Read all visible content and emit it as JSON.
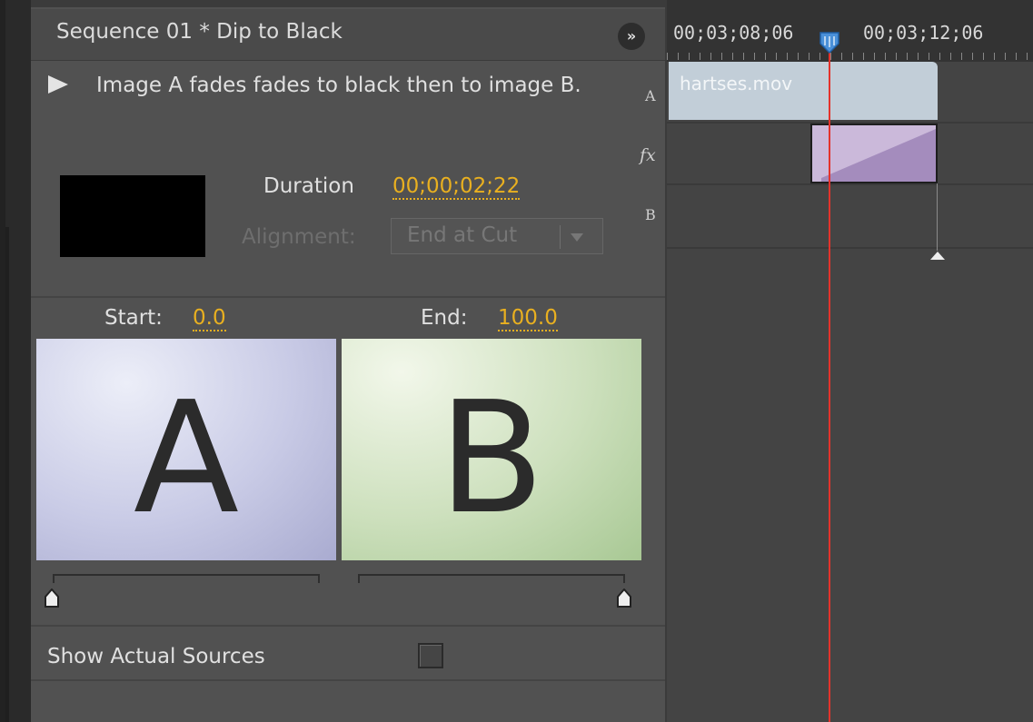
{
  "header": {
    "title": "Sequence 01 * Dip to Black",
    "menu_icon": "panel-menu-icon"
  },
  "effect": {
    "description": "Image A fades fades to black then to image B.",
    "duration_label": "Duration",
    "duration_value": "00;00;02;22",
    "alignment_label": "Alignment:",
    "alignment_value": "End at Cut"
  },
  "track_labels": {
    "a": "A",
    "fx": "fx",
    "b": "B"
  },
  "preview": {
    "start_label": "Start:",
    "start_value": "0.0",
    "end_label": "End:",
    "end_value": "100.0",
    "image_a_letter": "A",
    "image_b_letter": "B",
    "start_slider_fraction": 0.0,
    "end_slider_fraction": 1.0
  },
  "show_actual_sources": {
    "label": "Show Actual Sources",
    "checked": false
  },
  "timeline": {
    "timecode_left": "00;03;08;06",
    "timecode_right": "00;03;12;06",
    "clip_name": "hartses.mov",
    "playhead_color": "#e4332b"
  },
  "colors": {
    "accent_value": "#e9b020",
    "panel_bg": "#515151"
  }
}
